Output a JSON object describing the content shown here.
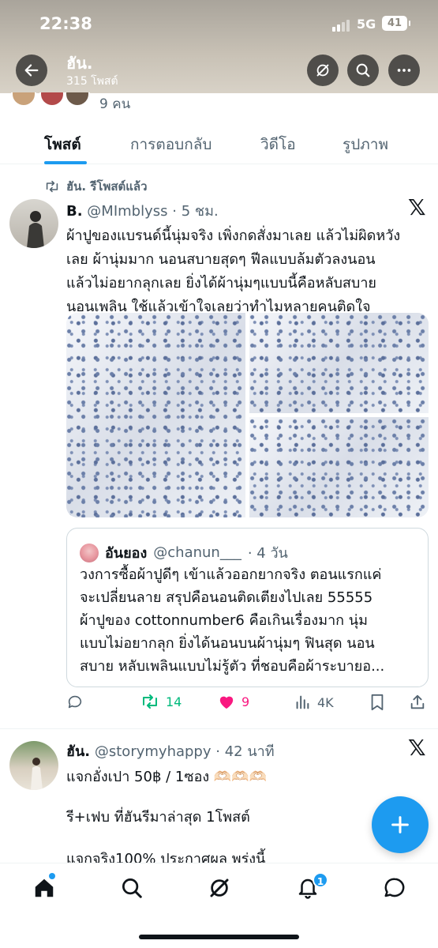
{
  "status_bar": {
    "time": "22:38",
    "network": "5G",
    "battery": "41"
  },
  "header": {
    "name": "ฮัน.",
    "post_count": "315 โพสต์"
  },
  "followers_peek": {
    "text": "9 คน"
  },
  "tabs": [
    {
      "label": "โพสต์",
      "active": true
    },
    {
      "label": "การตอบกลับ",
      "active": false
    },
    {
      "label": "วิดีโอ",
      "active": false
    },
    {
      "label": "รูปภาพ",
      "active": false
    }
  ],
  "post1": {
    "repost_label": "ฮัน. รีโพสต์แล้ว",
    "display_name": "B.",
    "handle": "@MImblyss",
    "time": "· 5 ชม.",
    "lines": [
      "ผ้าปูของแบรนด์นี้นุ่มจริง เพิ่งกดสั่งมาเลย แล้วไม่ผิดหวัง",
      "เลย ผ้านุ่มมาก นอนสบายสุดๆ ฟีลแบบล้มตัวลงนอน",
      "แล้วไม่อยากลุกเลย ยิ่งได้ผ้านุ่มๆแบบนี้คือหลับสบาย",
      "นอนเพลิน ใช้แล้วเข้าใจเลยว่าทำไมหลายคนติดใจ"
    ],
    "quote": {
      "display_name": "อันยอง",
      "handle": "@chanun___",
      "time": "· 4 วัน",
      "lines": [
        "วงการซื้อผ้าปูดีๆ เข้าแล้วออกยากจริง ตอนแรกแค่",
        "จะเปลี่ยนลาย สรุปคือนอนติดเตียงไปเลย 55555",
        "ผ้าปูของ  cottonnumber6 คือเกินเรื่องมาก นุ่ม",
        "แบบไม่อยากลุก ยิ่งได้นอนบนผ้านุ่มๆ ฟินสุด นอน",
        "สบาย หลับเพลินแบบไม่รู้ตัว ที่ชอบคือผ้าระบายอ..."
      ]
    },
    "actions": {
      "reposts": "14",
      "likes": "9",
      "views": "4K"
    }
  },
  "post2": {
    "display_name": "ฮัน.",
    "handle": "@storymyhappy",
    "time": "· 42 นาที",
    "lines": [
      "แจกอั่งเปา 50฿  / 1ซอง 🫶🏻🫶🏻🫶🏻",
      "รี+เฟบ ที่ฮันรีมาล่าสุด  1โพสต์",
      "แจกจริง100%  ประกาศผล พรุ่งนี้"
    ]
  },
  "nav": {
    "notifications_badge": "1"
  },
  "colors": {
    "accent": "#1d9bf0",
    "repost_green": "#00ba7c",
    "like_pink": "#f91880"
  }
}
